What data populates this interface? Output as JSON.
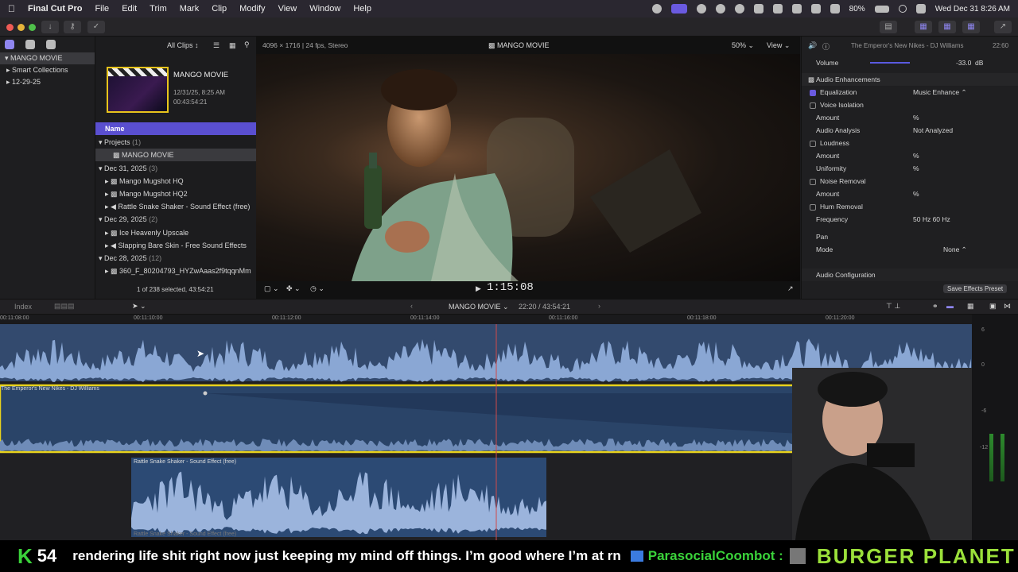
{
  "menubar": {
    "app": "Final Cut Pro",
    "items": [
      "File",
      "Edit",
      "Trim",
      "Mark",
      "Clip",
      "Modify",
      "View",
      "Window",
      "Help"
    ],
    "battery": "80%",
    "datetime": "Wed Dec 31  8:26 AM"
  },
  "sidebar": {
    "items": [
      {
        "label": "MANGO MOVIE"
      },
      {
        "label": "Smart Collections"
      },
      {
        "label": "12-29-25"
      }
    ]
  },
  "browser": {
    "filter": "All Clips",
    "project_thumb": {
      "title": "MANGO MOVIE",
      "date": "12/31/25, 8:25 AM",
      "duration": "00:43:54:21"
    },
    "column_name": "Name",
    "groups": [
      {
        "label": "Projects",
        "count": "(1)",
        "items": [
          "MANGO MOVIE"
        ]
      },
      {
        "label": "Dec 31, 2025",
        "count": "(3)",
        "items": [
          "Mango Mugshot HQ",
          "Mango Mugshot HQ2",
          "Rattle Snake Shaker - Sound Effect (free)"
        ]
      },
      {
        "label": "Dec 29, 2025",
        "count": "(2)",
        "items": [
          "Ice Heavenly Upscale",
          "Slapping Bare Skin - Free Sound Effects"
        ]
      },
      {
        "label": "Dec 28, 2025",
        "count": "(12)",
        "items": [
          "360_F_80204793_HYZwAaas2f9tqqnMm"
        ]
      }
    ],
    "selection_status": "1 of 238 selected, 43:54:21"
  },
  "viewer": {
    "format": "4096 × 1716 | 24 fps, Stereo",
    "title": "MANGO MOVIE",
    "zoom": "50%",
    "view_menu": "View",
    "timecode": "1:15:08"
  },
  "inspector": {
    "clip_title": "The Emperor's New Nikes - DJ Williams",
    "clip_time": "22:60",
    "volume_label": "Volume",
    "volume_value": "-33.0",
    "volume_unit": "dB",
    "section": "Audio Enhancements",
    "rows": [
      {
        "label": "Equalization",
        "checked": true,
        "value": "Music Enhance ⌃"
      },
      {
        "label": "Voice Isolation",
        "checked": false,
        "value": ""
      },
      {
        "label": "Amount",
        "checked": null,
        "value": "%"
      },
      {
        "label": "Audio Analysis",
        "checked": null,
        "value": "Not Analyzed"
      },
      {
        "label": "Loudness",
        "checked": false,
        "value": ""
      },
      {
        "label": "Amount",
        "checked": null,
        "value": "%"
      },
      {
        "label": "Uniformity",
        "checked": null,
        "value": "%"
      },
      {
        "label": "Noise Removal",
        "checked": false,
        "value": ""
      },
      {
        "label": "Amount",
        "checked": null,
        "value": "%"
      },
      {
        "label": "Hum Removal",
        "checked": false,
        "value": ""
      },
      {
        "label": "Frequency",
        "checked": null,
        "value": "50 Hz      60 Hz"
      }
    ],
    "pan_section": "Pan",
    "mode_label": "Mode",
    "mode_value": "None ⌃",
    "audio_config": "Audio Configuration",
    "save_preset": "Save Effects Preset"
  },
  "timeline": {
    "index_label": "Index",
    "project_name": "MANGO MOVIE",
    "project_time": "22:20 / 43:54:21",
    "ruler_ticks": [
      "00:11:08:00",
      "00:11:10:00",
      "00:11:12:00",
      "00:11:14:00",
      "00:11:16:00",
      "00:11:18:00",
      "00:11:20:00"
    ],
    "clips": [
      {
        "name": "The Emperor's New Nikes - DJ Williams"
      },
      {
        "name": "Rattle Snake Shaker - Sound Effect (free)"
      },
      {
        "name": "Rattle Snake Shaker - Sound Effect (free)"
      }
    ],
    "meter_labels": [
      "6",
      "0",
      "-6",
      "-12"
    ]
  },
  "ticker": {
    "k_badge": "K",
    "count": "54",
    "message": "rendering life shit right now just keeping my mind off things. I’m good where I’m at rn",
    "user": "ParasocialCoombot :",
    "logo": "BURGER PLANET"
  },
  "colors": {
    "accent": "#6a5ae0",
    "clip_border": "#e8d21c",
    "playhead": "#d04a4a",
    "audio": "#8aa7d4"
  }
}
